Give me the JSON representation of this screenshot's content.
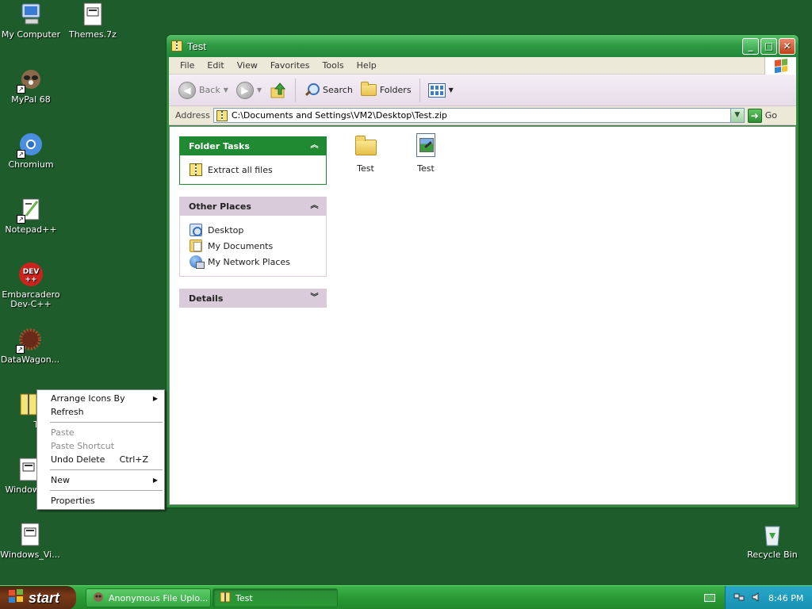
{
  "desktop": {
    "icons": [
      {
        "label": "My Computer"
      },
      {
        "label": "Themes.7z"
      },
      {
        "label": "MyPal 68"
      },
      {
        "label": "Chromium"
      },
      {
        "label": "Notepad++"
      },
      {
        "label": "Embarcadero Dev-C++"
      },
      {
        "label": "DataWagon..."
      },
      {
        "label": "Tes"
      },
      {
        "label": "Windows"
      },
      {
        "label": "Windows_Vi..."
      },
      {
        "label": "Recycle Bin"
      }
    ]
  },
  "window": {
    "title": "Test",
    "menu": [
      "File",
      "Edit",
      "View",
      "Favorites",
      "Tools",
      "Help"
    ],
    "toolbar": {
      "back_label": "Back",
      "search_label": "Search",
      "folders_label": "Folders"
    },
    "address": {
      "label": "Address",
      "value": "C:\\Documents and Settings\\VM2\\Desktop\\Test.zip",
      "go_label": "Go"
    },
    "taskpane": {
      "folder_tasks": {
        "title": "Folder Tasks",
        "items": [
          "Extract all files"
        ]
      },
      "other_places": {
        "title": "Other Places",
        "items": [
          "Desktop",
          "My Documents",
          "My Network Places"
        ]
      },
      "details": {
        "title": "Details"
      }
    },
    "files": [
      {
        "label": "Test",
        "icon": "folder-icon"
      },
      {
        "label": "Test",
        "icon": "image-file-icon"
      }
    ]
  },
  "context_menu": {
    "items": [
      {
        "label": "Arrange Icons By",
        "shortcut": "",
        "submenu": true,
        "disabled": false
      },
      {
        "label": "Refresh",
        "shortcut": "",
        "submenu": false,
        "disabled": false
      },
      {
        "label": "Paste",
        "shortcut": "",
        "submenu": false,
        "disabled": true
      },
      {
        "label": "Paste Shortcut",
        "shortcut": "",
        "submenu": false,
        "disabled": true
      },
      {
        "label": "Undo Delete",
        "shortcut": "Ctrl+Z",
        "submenu": false,
        "disabled": false
      },
      {
        "label": "New",
        "shortcut": "",
        "submenu": true,
        "disabled": false
      },
      {
        "label": "Properties",
        "shortcut": "",
        "submenu": false,
        "disabled": false
      }
    ]
  },
  "taskbar": {
    "start_label": "start",
    "tasks": [
      {
        "label": "Anonymous File Uplo..."
      },
      {
        "label": "Test"
      }
    ],
    "clock": "8:46 PM"
  },
  "colors": {
    "desktop_bg": "#1e5d2b",
    "theme_green": "#2e8b3c",
    "taskpane_green": "#1f8a32",
    "taskpane_purple": "#d9cbd9"
  }
}
